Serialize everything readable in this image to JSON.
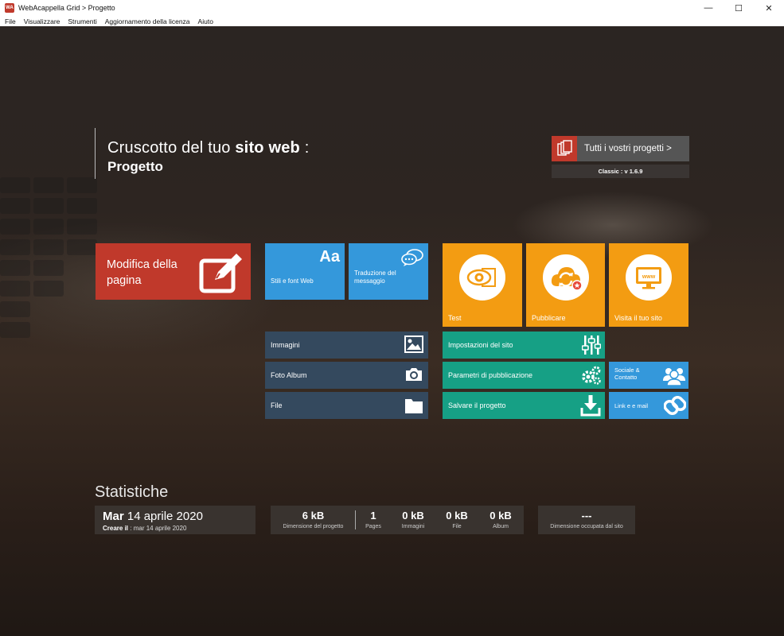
{
  "window": {
    "title": "WebAcappella Grid > Progetto",
    "app_icon_text": "WA",
    "minimize": "—",
    "maximize": "☐",
    "close": "✕"
  },
  "menu": [
    "File",
    "Visualizzare",
    "Strumenti",
    "Aggiornamento della licenza",
    "Aiuto"
  ],
  "header": {
    "title_prefix": "Cruscotto del tuo ",
    "title_bold": "sito web",
    "title_suffix": " :",
    "project_name": "Progetto",
    "projects_button": "Tutti i vostri progetti >",
    "version": "Classic : v 1.6.9"
  },
  "tiles": {
    "edit_page": "Modifica della pagina",
    "styles_fonts": "Stili e font Web",
    "styles_glyph": "Aa",
    "translation": "Traduzione del messaggio",
    "test": "Test",
    "publish": "Pubblicare",
    "visit_site": "Visita il tuo sito",
    "www_glyph": "www",
    "images": "Immagini",
    "photo_album": "Foto Album",
    "file": "File",
    "site_settings": "Impostazioni del sito",
    "publish_params": "Parametri di pubblicazione",
    "save_project": "Salvare il progetto",
    "social_contact": "Sociale & Contatto",
    "link_email": "Link e e mail"
  },
  "stats": {
    "title": "Statistiche",
    "date_day": "Mar",
    "date_rest": " 14 aprile 2020",
    "created_label": "Creare il",
    "created_value": " : mar 14 aprile 2020",
    "project_size_value": "6 kB",
    "project_size_label": "Dimensione del progetto",
    "pages_value": "1",
    "pages_label": "Pages",
    "images_value": "0 kB",
    "images_label": "Immagini",
    "file_value": "0 kB",
    "file_label": "File",
    "album_value": "0 kB",
    "album_label": "Album",
    "site_size_value": "---",
    "site_size_label": "Dimensione occupata dal sito"
  },
  "colors": {
    "red": "#c0392b",
    "blue": "#3498db",
    "orange": "#f39c12",
    "navy": "#34495e",
    "teal": "#16a085"
  }
}
